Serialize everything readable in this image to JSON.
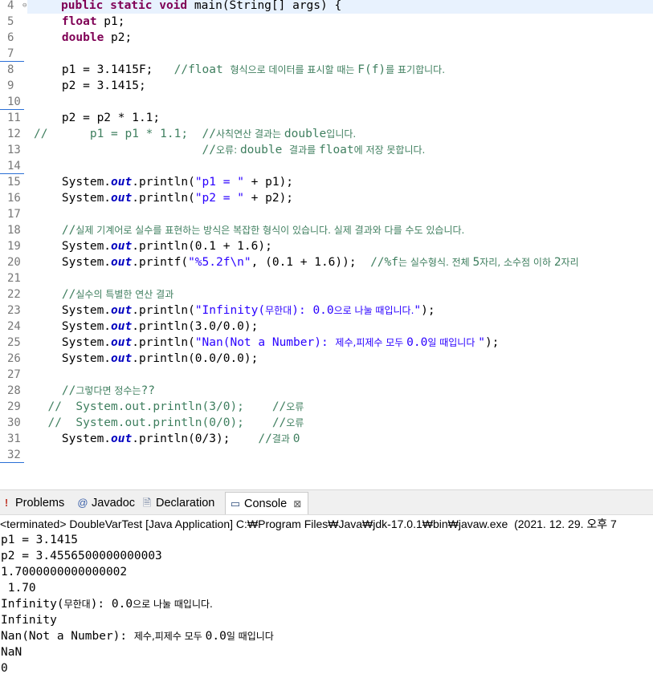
{
  "editor": {
    "line_numbers": [
      "4",
      "5",
      "6",
      "7",
      "8",
      "9",
      "10",
      "11",
      "12",
      "13",
      "14",
      "15",
      "16",
      "17",
      "18",
      "19",
      "20",
      "21",
      "22",
      "23",
      "24",
      "25",
      "26",
      "27",
      "28",
      "29",
      "30",
      "31",
      "32"
    ],
    "lines": [
      {
        "parts": [
          [
            "kw",
            "public static void "
          ],
          [
            "",
            "main(String[] "
          ],
          [
            "",
            "args"
          ],
          [
            "",
            ") {"
          ]
        ]
      },
      {
        "parts": [
          [
            "",
            "    "
          ],
          [
            "kw",
            "float"
          ],
          [
            "",
            " p1;"
          ]
        ]
      },
      {
        "parts": [
          [
            "",
            "    "
          ],
          [
            "kw",
            "double"
          ],
          [
            "",
            " p2;"
          ]
        ]
      },
      {
        "parts": []
      },
      {
        "parts": [
          [
            "",
            "    p1 = 3.1415F;   "
          ],
          [
            "cmt",
            "//float "
          ],
          [
            "cmt kr",
            "형식으로 데이터를 표시할 때는 "
          ],
          [
            "cmt",
            "F(f)"
          ],
          [
            "cmt kr",
            "를 표기합니다."
          ]
        ]
      },
      {
        "parts": [
          [
            "",
            "    p2 = 3.1415;"
          ]
        ]
      },
      {
        "parts": []
      },
      {
        "parts": [
          [
            "",
            "    p2 = p2 * 1.1;"
          ]
        ]
      },
      {
        "parts": [
          [
            "cmt",
            "//      p1 = p1 * 1.1;  "
          ],
          [
            "cmt",
            "//"
          ],
          [
            "cmt kr",
            "사칙연산 결과는 "
          ],
          [
            "cmt",
            "double"
          ],
          [
            "cmt kr",
            "입니다."
          ]
        ]
      },
      {
        "parts": [
          [
            "",
            "                        "
          ],
          [
            "cmt",
            "//"
          ],
          [
            "cmt kr",
            "오류: "
          ],
          [
            "cmt",
            "double "
          ],
          [
            "cmt kr",
            "결과를 "
          ],
          [
            "cmt",
            "float"
          ],
          [
            "cmt kr",
            "에 저장 못합니다."
          ]
        ]
      },
      {
        "parts": []
      },
      {
        "parts": [
          [
            "",
            "    System."
          ],
          [
            "fld",
            "out"
          ],
          [
            "",
            ".println("
          ],
          [
            "str",
            "\"p1 = \""
          ],
          [
            "",
            " + p1);"
          ]
        ]
      },
      {
        "parts": [
          [
            "",
            "    System."
          ],
          [
            "fld",
            "out"
          ],
          [
            "",
            ".println("
          ],
          [
            "str",
            "\"p2 = \""
          ],
          [
            "",
            " + p2);"
          ]
        ]
      },
      {
        "parts": []
      },
      {
        "parts": [
          [
            "",
            "    "
          ],
          [
            "cmt",
            "//"
          ],
          [
            "cmt kr",
            "실제 기계어로 실수를 표현하는 방식은 복잡한 형식이 있습니다. 실제 결과와 다를 수도 있습니다."
          ]
        ]
      },
      {
        "parts": [
          [
            "",
            "    System."
          ],
          [
            "fld",
            "out"
          ],
          [
            "",
            ".println(0.1 + 1.6);"
          ]
        ]
      },
      {
        "parts": [
          [
            "",
            "    System."
          ],
          [
            "fld",
            "out"
          ],
          [
            "",
            ".printf("
          ],
          [
            "str",
            "\"%5.2f\\n\""
          ],
          [
            "",
            ", (0.1 + 1.6));  "
          ],
          [
            "cmt",
            "//%f"
          ],
          [
            "cmt kr",
            "는 실수형식. 전체 "
          ],
          [
            "cmt",
            "5"
          ],
          [
            "cmt kr",
            "자리, 소수점 이하 "
          ],
          [
            "cmt",
            "2"
          ],
          [
            "cmt kr",
            "자리"
          ]
        ]
      },
      {
        "parts": []
      },
      {
        "parts": [
          [
            "",
            "    "
          ],
          [
            "cmt",
            "//"
          ],
          [
            "cmt kr",
            "실수의 특별한 연산 결과"
          ]
        ]
      },
      {
        "parts": [
          [
            "",
            "    System."
          ],
          [
            "fld",
            "out"
          ],
          [
            "",
            ".println("
          ],
          [
            "str",
            "\"Infinity("
          ],
          [
            "str kr",
            "무한대"
          ],
          [
            "str",
            "): 0.0"
          ],
          [
            "str kr",
            "으로 나눌 때입니다."
          ],
          [
            "str",
            "\""
          ],
          [
            "",
            ");"
          ]
        ]
      },
      {
        "parts": [
          [
            "",
            "    System."
          ],
          [
            "fld",
            "out"
          ],
          [
            "",
            ".println(3.0/0.0);"
          ]
        ]
      },
      {
        "parts": [
          [
            "",
            "    System."
          ],
          [
            "fld",
            "out"
          ],
          [
            "",
            ".println("
          ],
          [
            "str",
            "\"Nan(Not a Number): "
          ],
          [
            "str kr",
            "제수,피제수 모두 "
          ],
          [
            "str",
            "0.0"
          ],
          [
            "str kr",
            "일 때입니다 "
          ],
          [
            "str",
            "\""
          ],
          [
            "",
            ");"
          ]
        ]
      },
      {
        "parts": [
          [
            "",
            "    System."
          ],
          [
            "fld",
            "out"
          ],
          [
            "",
            ".println(0.0/0.0);"
          ]
        ]
      },
      {
        "parts": []
      },
      {
        "parts": [
          [
            "",
            "    "
          ],
          [
            "cmt",
            "//"
          ],
          [
            "cmt kr",
            "그렇다면 정수는"
          ],
          [
            "cmt",
            "??"
          ]
        ]
      },
      {
        "parts": [
          [
            "",
            "  "
          ],
          [
            "cmt",
            "//  System.out.println(3/0);    //"
          ],
          [
            "cmt kr",
            "오류"
          ]
        ]
      },
      {
        "parts": [
          [
            "",
            "  "
          ],
          [
            "cmt",
            "//  System.out.println(0/0);    //"
          ],
          [
            "cmt kr",
            "오류"
          ]
        ]
      },
      {
        "parts": [
          [
            "",
            "    System."
          ],
          [
            "fld",
            "out"
          ],
          [
            "",
            ".println(0/3);    "
          ],
          [
            "cmt",
            "//"
          ],
          [
            "cmt kr",
            "결과 "
          ],
          [
            "cmt",
            "0"
          ]
        ]
      },
      {
        "parts": []
      }
    ],
    "indent_offsets": [
      1,
      0,
      0,
      0,
      0,
      0,
      0,
      0,
      0,
      0,
      0,
      0,
      0,
      0,
      0,
      0,
      0,
      0,
      0,
      0,
      0,
      0,
      0,
      0,
      0,
      0,
      0,
      0,
      0
    ],
    "scroll_left_arrow": "<"
  },
  "tabs": [
    {
      "label": "Problems",
      "icon": "problems-icon",
      "glyph": "!"
    },
    {
      "label": "Javadoc",
      "icon": "javadoc-icon",
      "glyph": "@"
    },
    {
      "label": "Declaration",
      "icon": "declaration-icon",
      "glyph": "🗎"
    },
    {
      "label": "Console",
      "icon": "console-icon",
      "glyph": "▭",
      "active": true,
      "close": "⊠"
    }
  ],
  "console": {
    "header": "<terminated> DoubleVarTest [Java Application] C:₩Program Files₩Java₩jdk-17.0.1₩bin₩javaw.exe  (2021. 12. 29. 오후 7",
    "output": [
      [
        [
          "",
          "p1 = 3.1415"
        ]
      ],
      [
        [
          "",
          "p2 = 3.4556500000000003"
        ]
      ],
      [
        [
          "",
          "1.7000000000000002"
        ]
      ],
      [
        [
          "",
          " 1.70"
        ]
      ],
      [
        [
          "",
          "Infinity("
        ],
        [
          "kr",
          "무한대"
        ],
        [
          "",
          "): 0.0"
        ],
        [
          "kr",
          "으로 나눌 때입니다."
        ]
      ],
      [
        [
          "",
          "Infinity"
        ]
      ],
      [
        [
          "",
          "Nan(Not a Number): "
        ],
        [
          "kr",
          "제수,피제수 모두 "
        ],
        [
          "",
          "0.0"
        ],
        [
          "kr",
          "일 때입니다"
        ]
      ],
      [
        [
          "",
          "NaN"
        ]
      ],
      [
        [
          "",
          "0"
        ]
      ]
    ]
  }
}
